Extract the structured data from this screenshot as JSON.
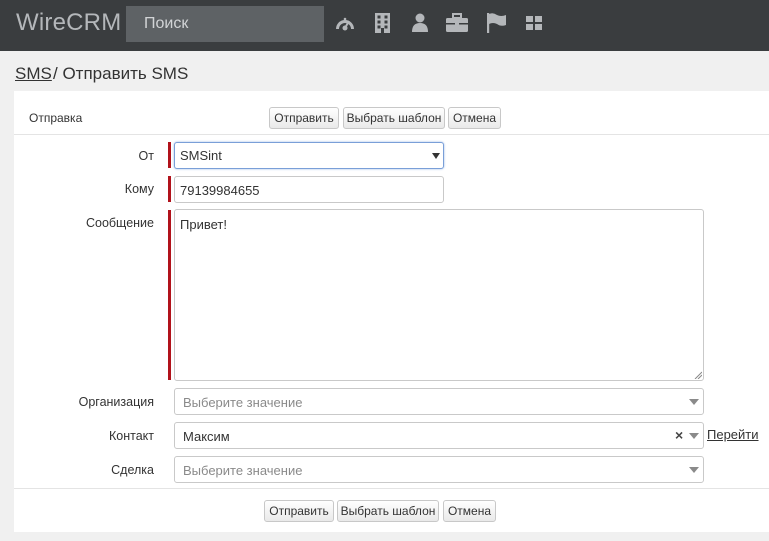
{
  "app": {
    "brand": "WireCRM",
    "search_placeholder": "Поиск",
    "nav_icons": [
      "dashboard-icon",
      "building-icon",
      "user-icon",
      "briefcase-icon",
      "flag-icon",
      "grid-icon"
    ]
  },
  "breadcrumb": {
    "link": "SMS",
    "rest": "/ Отправить SMS"
  },
  "form": {
    "section_title": "Отправка",
    "buttons": {
      "send": "Отправить",
      "template": "Выбрать шаблон",
      "cancel": "Отмена"
    },
    "fields": {
      "from": {
        "label": "От",
        "value": "SMSint"
      },
      "to": {
        "label": "Кому",
        "value": "79139984655"
      },
      "message": {
        "label": "Сообщение",
        "value": "Привет!"
      },
      "organization": {
        "label": "Организация",
        "placeholder": "Выберите значение"
      },
      "contact": {
        "label": "Контакт",
        "value": "Максим",
        "clear": "×",
        "link": "Перейти"
      },
      "deal": {
        "label": "Сделка",
        "placeholder": "Выберите значение"
      }
    }
  },
  "colors": {
    "topbar": "#3a3d3f",
    "required_marker": "#b1121b",
    "focus_border": "#7a9fd8"
  }
}
